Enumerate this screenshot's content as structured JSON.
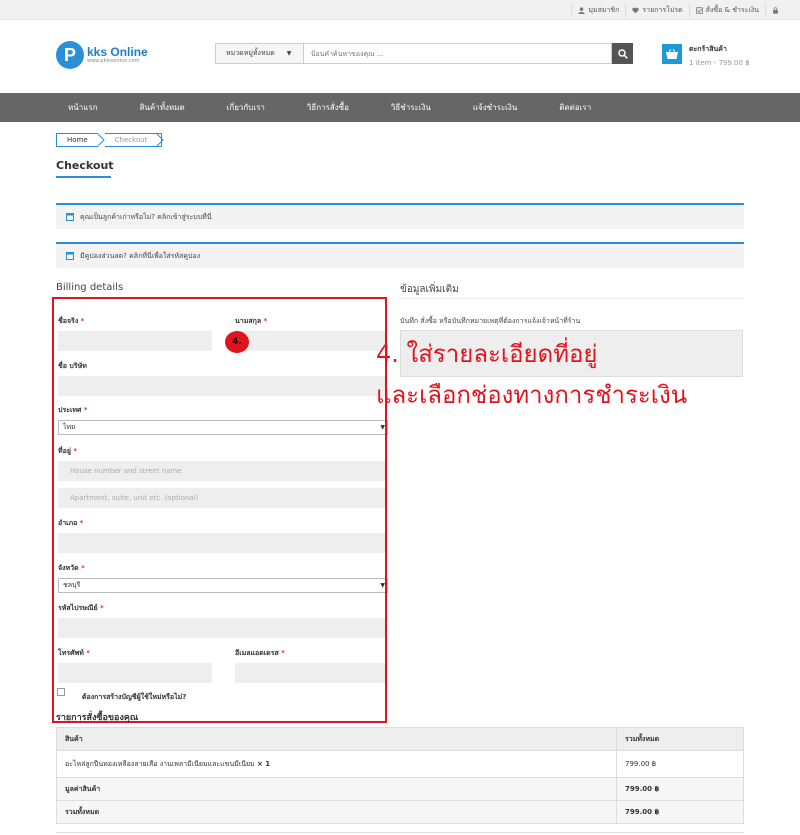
{
  "topbar": {
    "items": [
      {
        "label": "มุมสมาชิก",
        "icon": "user-icon"
      },
      {
        "label": "รายการโปรด",
        "icon": "heart-icon"
      },
      {
        "label": "สั่งซื้อ & ชำระเงิน",
        "icon": "checkbox-icon"
      },
      {
        "label": "",
        "icon": "lock-icon"
      }
    ]
  },
  "logo": {
    "letter": "P",
    "brand": "kks Online",
    "sub": "www.pkksonline.com"
  },
  "search": {
    "category": "หมวดหมู่ทั้งหมด",
    "placeholder": "ป้อนคำค้นหาของคุณ ..."
  },
  "cart": {
    "title": "ตะกร้าสินค้า",
    "summary": "1 item - 799.00 ฿"
  },
  "nav": [
    "หน้าแรก",
    "สินค้าทั้งหมด",
    "เกี่ยวกับเรา",
    "วิธีการสั่งซื้อ",
    "วิธีชำระเงิน",
    "แจ้งชำระเงิน",
    "ติดต่อเรา"
  ],
  "breadcrumb": {
    "home": "Home",
    "current": "Checkout"
  },
  "page_title": "Checkout",
  "notices": {
    "returning": "คุณเป็นลูกค้าเก่าหรือไม่? คลิกเข้าสู่ระบบที่นี่",
    "coupon": "มีคูปองส่วนลด? คลิกที่นี่เพื่อใส่รหัสคูปอง"
  },
  "billing": {
    "heading": "Billing details",
    "first_name": "ชื่อจริง",
    "last_name": "นามสกุล",
    "company": "ชื่อ บริษัท",
    "country": "ประเทศ",
    "country_value": "ไทย",
    "address": "ที่อยู่",
    "address1_placeholder": "House number and street name",
    "address2_placeholder": "Apartment, suite, unit etc. (optional)",
    "city": "อำเภอ",
    "province": "จังหวัด",
    "province_value": "ชลบุรี",
    "postcode": "รหัสไปรษณีย์",
    "phone": "โทรศัพท์",
    "email": "อีเมลแอดเดรส",
    "create_account": "ต้องการสร้างบัญชีผู้ใช้ใหม่หรือไม่?",
    "req": "*"
  },
  "additional": {
    "heading": "ข้อมูลเพิ่มเติม",
    "notes_label": "บันทึก สั่งซื้อ หรือบันทึกหมายเหตุที่ต้องการแจ้งเจ้าหน้าที่ร้าน"
  },
  "annotation": {
    "badge": "4.",
    "line1": "4. ใส่รายละเอียดที่อยู่",
    "line2": "และเลือกช่องทางการชำระเงิน"
  },
  "order": {
    "heading": "รายการสั่งซื้อของคุณ",
    "col_product": "สินค้า",
    "col_total": "รวมทั้งหมด",
    "item_name": "อะไหล่ลูกปืนทองเหลืองลายเสือ งานเพลามีเนียมและแขนมีเนียม",
    "item_qty": "× 1",
    "item_price": "799.00 ฿",
    "subtotal_label": "มูลค่าสินค้า",
    "subtotal": "799.00 ฿",
    "total_label": "รวมทั้งหมด",
    "total": "799.00 ฿"
  }
}
